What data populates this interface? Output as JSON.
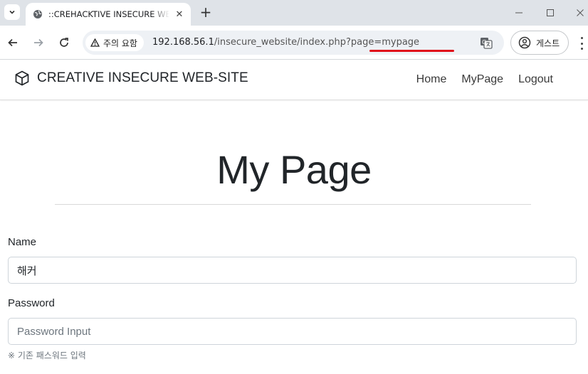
{
  "browser": {
    "tab_title": "::CREHACKTIVE INSECURE WEB-SITE",
    "security_label": "주의 요함",
    "url_host": "192.168.56.1",
    "url_path": "/insecure_website/index.php?page=mypage",
    "profile_label": "게스트"
  },
  "site": {
    "brand": "CREATIVE INSECURE WEB-SITE",
    "nav": [
      "Home",
      "MyPage",
      "Logout"
    ]
  },
  "page": {
    "title": "My Page",
    "name_label": "Name",
    "name_value": "해커",
    "password_label": "Password",
    "password_placeholder": "Password Input",
    "password_hint": "※ 기존 패스워드 입력"
  },
  "colors": {
    "annotation_underline": "#e0101a",
    "tabstrip": "#dfe3e8"
  }
}
